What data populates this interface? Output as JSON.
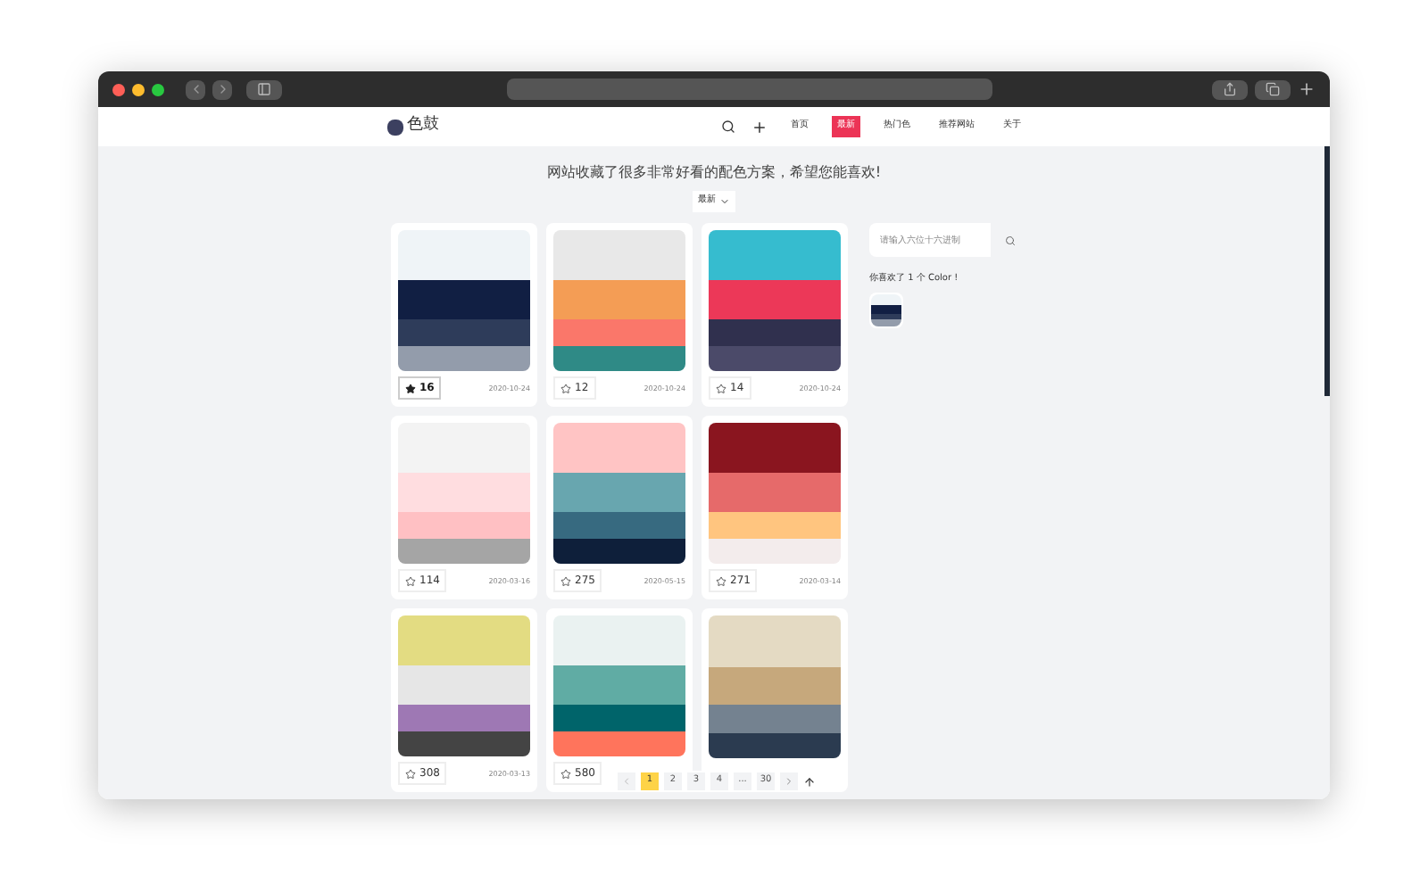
{
  "nav": {
    "logo": "色鼓",
    "items": [
      {
        "label": "首页",
        "selected": false
      },
      {
        "label": "最新",
        "selected": true
      },
      {
        "label": "热门色",
        "selected": false
      },
      {
        "label": "推荐网站",
        "selected": false
      },
      {
        "label": "关于",
        "selected": false
      }
    ]
  },
  "headline": "网站收藏了很多非常好看的配色方案，希望您能喜欢!",
  "sort": {
    "label": "最新"
  },
  "palettes": [
    {
      "stripes": [
        {
          "color": "#eff4f7"
        },
        {
          "color": "#111f43"
        },
        {
          "color": "#2e3c5a"
        },
        {
          "color": "#939cab"
        }
      ],
      "liked": true,
      "likes": "16",
      "date": "2020-10-24"
    },
    {
      "stripes": [
        {
          "color": "#e8e8e8"
        },
        {
          "color": "#f49d55"
        },
        {
          "color": "#fa776a"
        },
        {
          "color": "#2f8a86"
        }
      ],
      "liked": false,
      "likes": "12",
      "date": "2020-10-24"
    },
    {
      "stripes": [
        {
          "color": "#36bccf"
        },
        {
          "color": "#ec3858"
        },
        {
          "color": "#30304e"
        },
        {
          "color": "#4b4a69"
        }
      ],
      "liked": false,
      "likes": "14",
      "date": "2020-10-24"
    },
    {
      "stripes": [
        {
          "color": "#f3f3f3"
        },
        {
          "color": "#ffdde0"
        },
        {
          "color": "#ffc0c3"
        },
        {
          "color": "#a5a5a5"
        }
      ],
      "liked": false,
      "likes": "114",
      "date": "2020-03-16"
    },
    {
      "stripes": [
        {
          "color": "#ffc4c4"
        },
        {
          "color": "#68a6af"
        },
        {
          "color": "#376a80"
        },
        {
          "color": "#0e1f3a"
        }
      ],
      "liked": false,
      "likes": "275",
      "date": "2020-05-15"
    },
    {
      "stripes": [
        {
          "color": "#8a151f"
        },
        {
          "color": "#e66a6a"
        },
        {
          "color": "#ffc57f"
        },
        {
          "color": "#f3ecec"
        }
      ],
      "liked": false,
      "likes": "271",
      "date": "2020-03-14"
    },
    {
      "stripes": [
        {
          "color": "#e3dc82"
        },
        {
          "color": "#e6e6e6"
        },
        {
          "color": "#9e78b4"
        },
        {
          "color": "#444444"
        }
      ],
      "liked": false,
      "likes": "308",
      "date": "2020-03-13"
    },
    {
      "stripes": [
        {
          "color": "#eaf2f1"
        },
        {
          "color": "#60aca4"
        },
        {
          "color": "#00646a"
        },
        {
          "color": "#ff745c"
        }
      ],
      "liked": false,
      "likes": "580"
    },
    {
      "stripes": [
        {
          "color": "#e4dac3"
        },
        {
          "color": "#c6a87c"
        },
        {
          "color": "#748290"
        },
        {
          "color": "#2b3b50"
        }
      ]
    }
  ],
  "sidebar": {
    "search_placeholder": "请输入六位十六进制",
    "summary": "你喜欢了 1 个 Color !",
    "favorites": [
      {
        "stripes": [
          {
            "color": "#eff4f7"
          },
          {
            "color": "#111f43"
          },
          {
            "color": "#2e3c5a"
          },
          {
            "color": "#939cab"
          }
        ]
      }
    ]
  },
  "pagination": {
    "pages": [
      {
        "label": "1",
        "selected": true
      },
      {
        "label": "2",
        "selected": false
      },
      {
        "label": "3",
        "selected": false
      },
      {
        "label": "4",
        "selected": false
      },
      {
        "label": "...",
        "selected": false
      },
      {
        "label": "30",
        "selected": false
      }
    ]
  }
}
